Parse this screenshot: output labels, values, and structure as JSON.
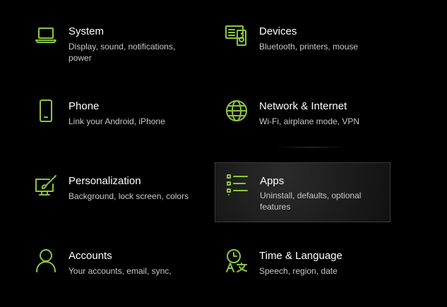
{
  "accent_color": "#8dc63f",
  "tiles": [
    {
      "title": "System",
      "desc": "Display, sound, notifications, power",
      "icon": "laptop-icon"
    },
    {
      "title": "Devices",
      "desc": "Bluetooth, printers, mouse",
      "icon": "devices-icon"
    },
    {
      "title": "Phone",
      "desc": "Link your Android, iPhone",
      "icon": "phone-icon"
    },
    {
      "title": "Network & Internet",
      "desc": "Wi-Fi, airplane mode, VPN",
      "icon": "globe-icon"
    },
    {
      "title": "Personalization",
      "desc": "Background, lock screen, colors",
      "icon": "paint-brush-icon"
    },
    {
      "title": "Apps",
      "desc": "Uninstall, defaults, optional features",
      "icon": "apps-list-icon"
    },
    {
      "title": "Accounts",
      "desc": "Your accounts, email, sync,",
      "icon": "person-icon"
    },
    {
      "title": "Time & Language",
      "desc": "Speech, region, date",
      "icon": "time-language-icon"
    }
  ]
}
